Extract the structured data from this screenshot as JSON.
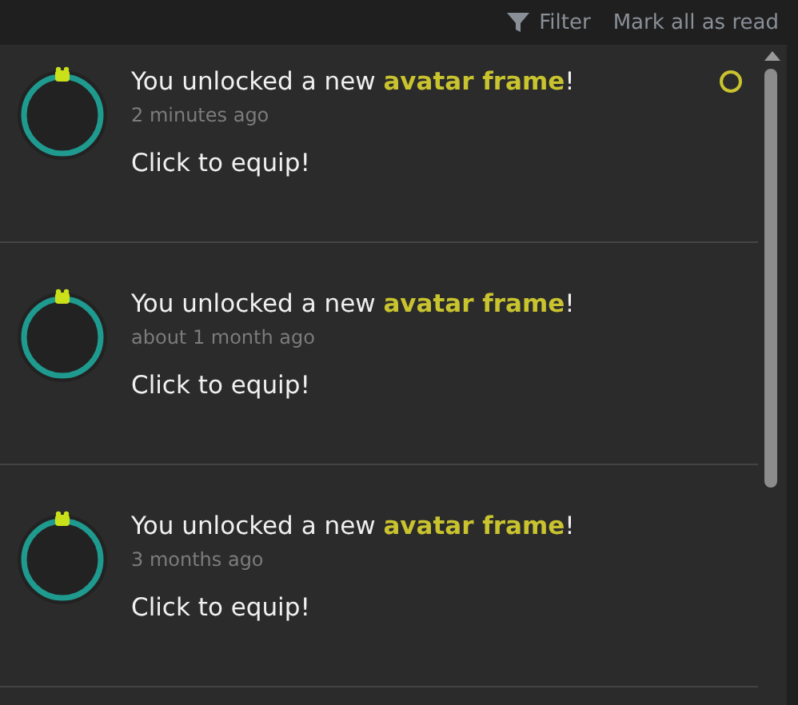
{
  "toolbar": {
    "filter": "Filter",
    "mark_all": "Mark all as read"
  },
  "notifications": [
    {
      "title": "You unlocked a new **avatar frame**!",
      "time": "2 minutes ago",
      "body": "Click to equip!",
      "unread": true
    },
    {
      "title": "You unlocked a new **avatar frame**!",
      "time": "about 1 month ago",
      "body": "Click to equip!",
      "unread": false
    },
    {
      "title": "You unlocked a new **avatar frame**!",
      "time": "3 months ago",
      "body": "Click to equip!",
      "unread": false
    }
  ]
}
